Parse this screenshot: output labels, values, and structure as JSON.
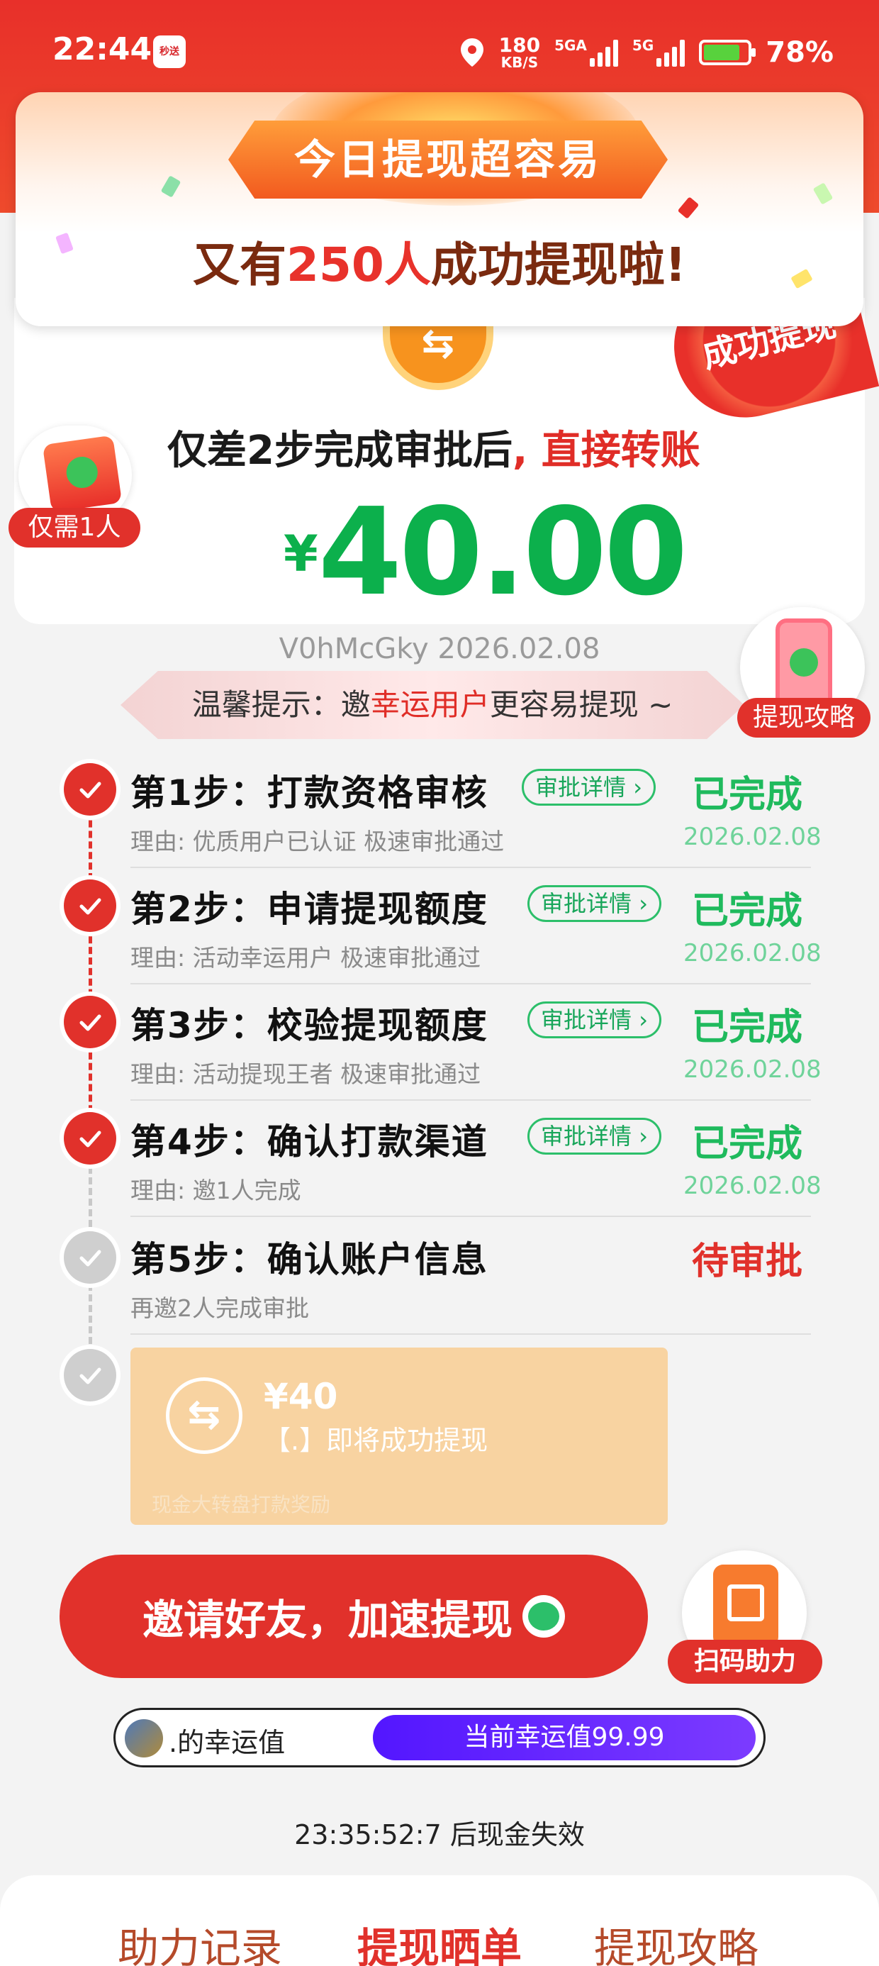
{
  "status_bar": {
    "time": "22:44",
    "net_speed_value": "180",
    "net_speed_unit": "KB/S",
    "net_5ga": "5GA",
    "net_5g": "5G",
    "battery": "78%"
  },
  "banner": {
    "ribbon": "今日提现超容易",
    "prefix": "又有",
    "count": "250人",
    "suffix": "成功提现啦!"
  },
  "seal_text": "成功提现",
  "only_one_label": "仅需1人",
  "headline": {
    "part1": "仅差2步完成审批后",
    "part2": ", 直接转账"
  },
  "amount": {
    "symbol": "¥",
    "value": "40.00"
  },
  "code_line": "V0hMcGky 2026.02.08",
  "tip": {
    "prefix": "温馨提示：邀",
    "highlight": "幸运用户",
    "suffix": "更容易提现 ~"
  },
  "guide_label": "提现攻略",
  "steps": [
    {
      "title": "第1步：打款资格审核",
      "detail": "审批详情",
      "reason": "理由: 优质用户已认证 极速审批通过",
      "status": "已完成",
      "date": "2026.02.08"
    },
    {
      "title": "第2步：申请提现额度",
      "detail": "审批详情",
      "reason": "理由: 活动幸运用户 极速审批通过",
      "status": "已完成",
      "date": "2026.02.08"
    },
    {
      "title": "第3步：校验提现额度",
      "detail": "审批详情",
      "reason": "理由: 活动提现王者 极速审批通过",
      "status": "已完成",
      "date": "2026.02.08"
    },
    {
      "title": "第4步：确认打款渠道",
      "detail": "审批详情",
      "reason": "理由: 邀1人完成",
      "status": "已完成",
      "date": "2026.02.08"
    },
    {
      "title": "第5步：确认账户信息",
      "reason": "再邀2人完成审批",
      "status": "待审批"
    }
  ],
  "voucher": {
    "amount": "¥40",
    "text": "【.】即将成功提现",
    "footer": "现金大转盘打款奖励"
  },
  "invite_button": "邀请好友，加速提现",
  "scan_label": "扫码助力",
  "lucky": {
    "label": ".的幸运值",
    "value_text": "当前幸运值99.99",
    "progress_percent": 99.99
  },
  "countdown": "23:35:52:7 后现金失效",
  "bottom_tabs": [
    "助力记录",
    "提现晒单",
    "提现攻略"
  ],
  "colors": {
    "brand_red": "#e1312b",
    "success_green": "#1fba5d",
    "amount_green": "#0cb04c",
    "lucky_purple": "#5316ff"
  }
}
